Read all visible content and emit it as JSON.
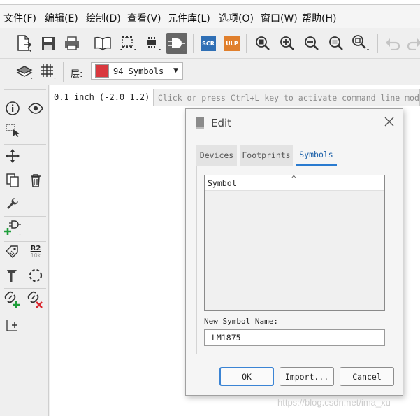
{
  "menu": {
    "items": [
      "文件(F)",
      "编辑(E)",
      "绘制(D)",
      "查看(V)",
      "元件库(L)",
      "选项(O)",
      "窗口(W)",
      "帮助(H)"
    ]
  },
  "toolbar": {
    "scr_label": "SCR",
    "ulp_label": "ULP"
  },
  "layer": {
    "label": "层:",
    "selected": "94 Symbols",
    "color": "#d9383e"
  },
  "sidebar": {
    "part_label_top": "R2",
    "part_label_bottom": "10k"
  },
  "status": {
    "coordinates": "0.1 inch (-2.0 1.2)",
    "command_placeholder": "Click or press Ctrl+L key to activate command line mode"
  },
  "dialog": {
    "title": "Edit",
    "tabs": [
      "Devices",
      "Footprints",
      "Symbols"
    ],
    "active_tab": "Symbols",
    "list_header": "Symbol",
    "field_label": "New Symbol Name:",
    "field_value": "LM1875",
    "buttons": {
      "ok": "OK",
      "import": "Import...",
      "cancel": "Cancel"
    }
  },
  "watermark": "https://blog.csdn.net/ima_xu",
  "colors": {
    "accent": "#2a7bd0",
    "scr": "#2f6fb5",
    "ulp": "#e07f2c"
  }
}
